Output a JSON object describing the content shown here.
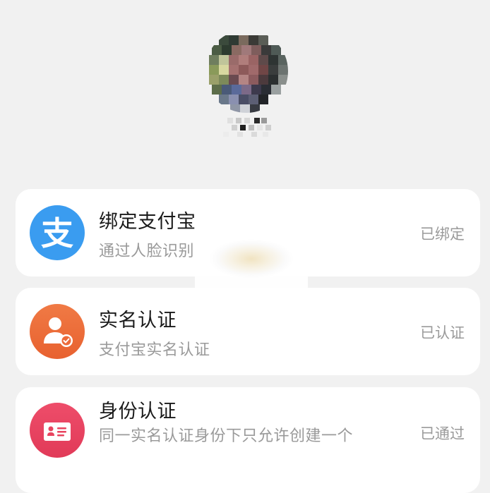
{
  "items": [
    {
      "title": "绑定支付宝",
      "subtitle": "通过人脸识别",
      "status": "已绑定",
      "icon": "alipay-icon",
      "color": "#3a9cf0"
    },
    {
      "title": "实名认证",
      "subtitle": "支付宝实名认证",
      "status": "已认证",
      "icon": "user-verified-icon",
      "color": "#ec6a3a"
    },
    {
      "title": "身份认证",
      "subtitle": "同一实名认证身份下只允许创建一个",
      "status": "已通过",
      "icon": "id-card-icon",
      "color": "#e8445f"
    }
  ]
}
